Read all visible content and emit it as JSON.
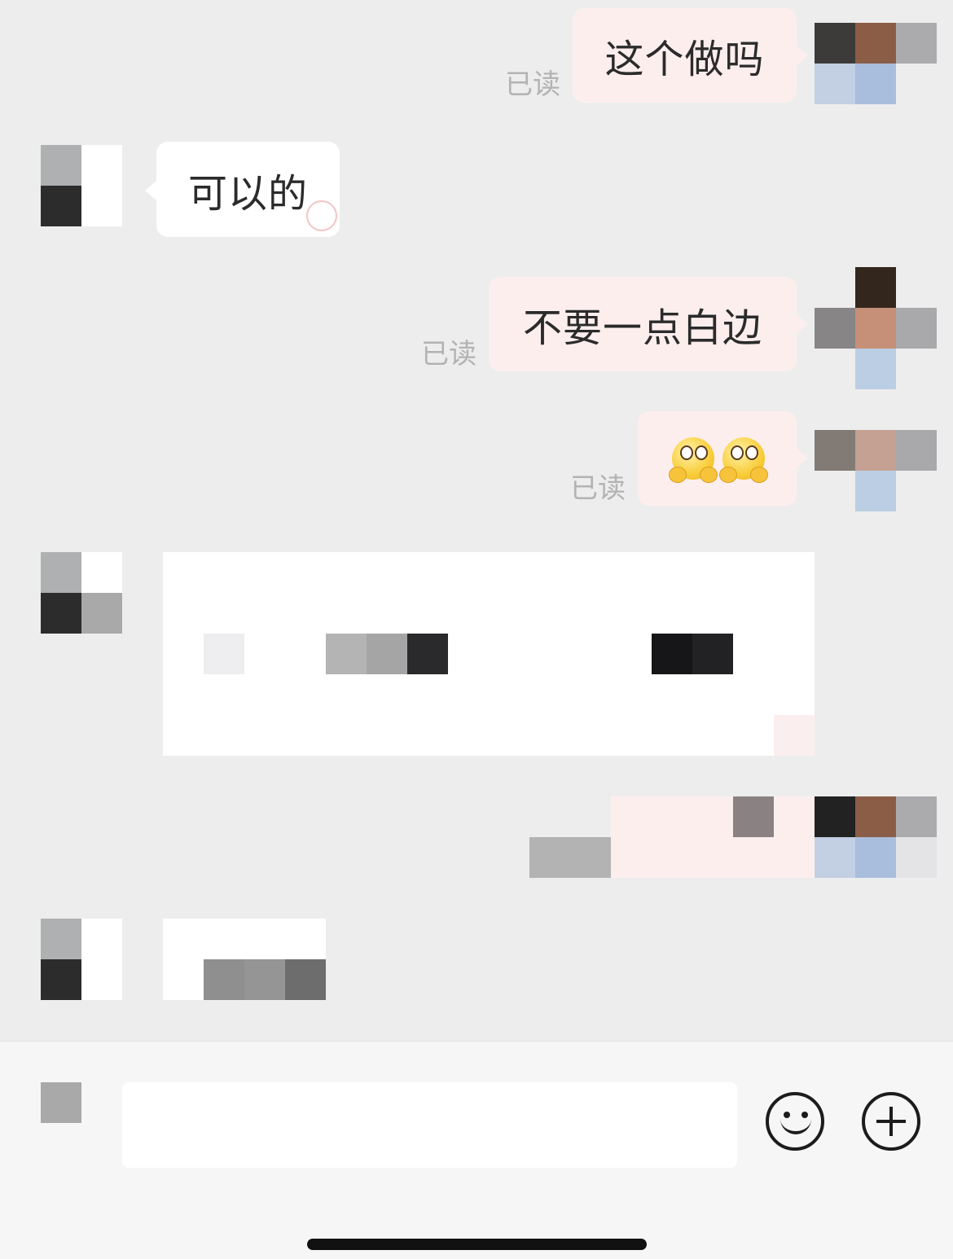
{
  "messages": [
    {
      "side": "me",
      "text": "这个做吗",
      "read_label": "已读"
    },
    {
      "side": "them",
      "text": "可以的"
    },
    {
      "side": "me",
      "text": "不要一点白边",
      "read_label": "已读"
    },
    {
      "side": "me",
      "emoji": "hugging-face-emoji x2",
      "read_label": "已读"
    }
  ],
  "colors": {
    "chat_bg": "#ededed",
    "my_bubble": "#fdeeee",
    "their_bubble": "#ffffff",
    "read_text": "#b3b3b3"
  },
  "bottom_bar": {
    "input_value": "",
    "icons": [
      "voice-icon",
      "emoji-icon",
      "add-icon"
    ]
  }
}
